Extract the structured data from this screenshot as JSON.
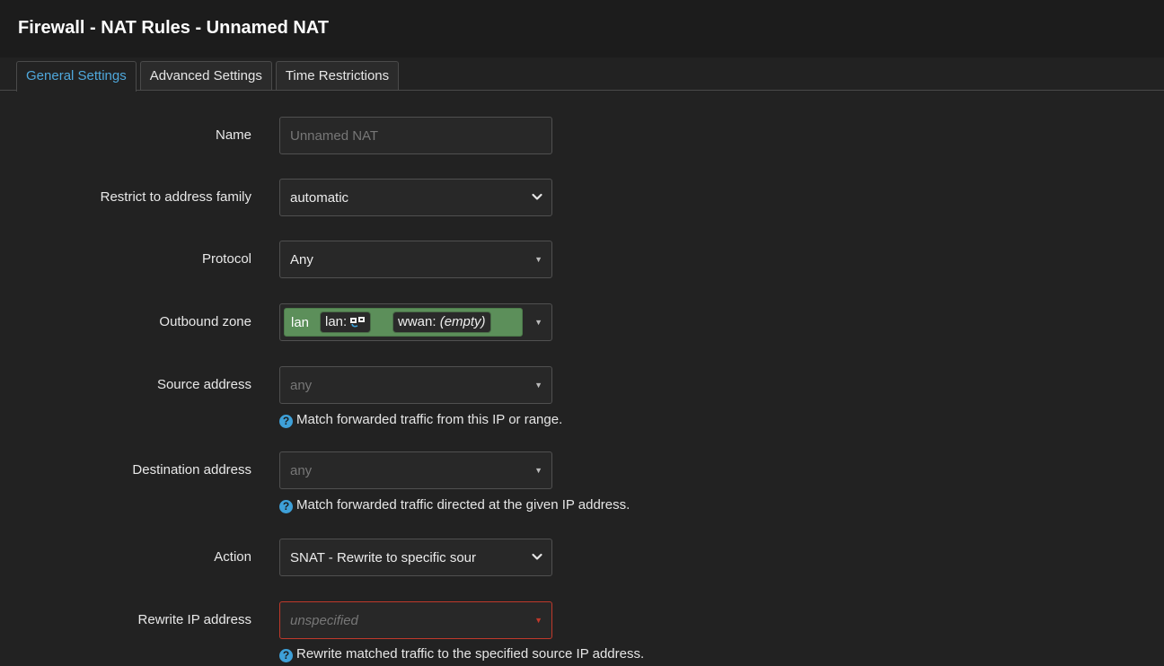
{
  "header": {
    "title": "Firewall - NAT Rules - Unnamed NAT"
  },
  "tabs": [
    {
      "label": "General Settings",
      "active": true
    },
    {
      "label": "Advanced Settings",
      "active": false
    },
    {
      "label": "Time Restrictions",
      "active": false
    }
  ],
  "form": {
    "name": {
      "label": "Name",
      "placeholder": "Unnamed NAT"
    },
    "family": {
      "label": "Restrict to address family",
      "value": "automatic"
    },
    "protocol": {
      "label": "Protocol",
      "value": "Any"
    },
    "outbound_zone": {
      "label": "Outbound zone",
      "zone": "lan",
      "chip_lan_label": "lan:",
      "chip_wwan_label": "wwan:",
      "chip_wwan_value": "(empty)"
    },
    "source": {
      "label": "Source address",
      "placeholder": "any",
      "help": "Match forwarded traffic from this IP or range."
    },
    "destination": {
      "label": "Destination address",
      "placeholder": "any",
      "help": "Match forwarded traffic directed at the given IP address."
    },
    "action": {
      "label": "Action",
      "value": "SNAT - Rewrite to specific sour"
    },
    "rewrite_ip": {
      "label": "Rewrite IP address",
      "placeholder": "unspecified",
      "help": "Rewrite matched traffic to the specified source IP address."
    }
  },
  "icons": {
    "help": "question-circle-icon",
    "network": "network-ports-icon",
    "dropdown": "chevron-down-icon",
    "caret": "caret-down-icon"
  },
  "colors": {
    "accent": "#4fa8dc",
    "zone_green": "#5c8f5a",
    "error_border": "#c0392b",
    "background": "#222222"
  }
}
